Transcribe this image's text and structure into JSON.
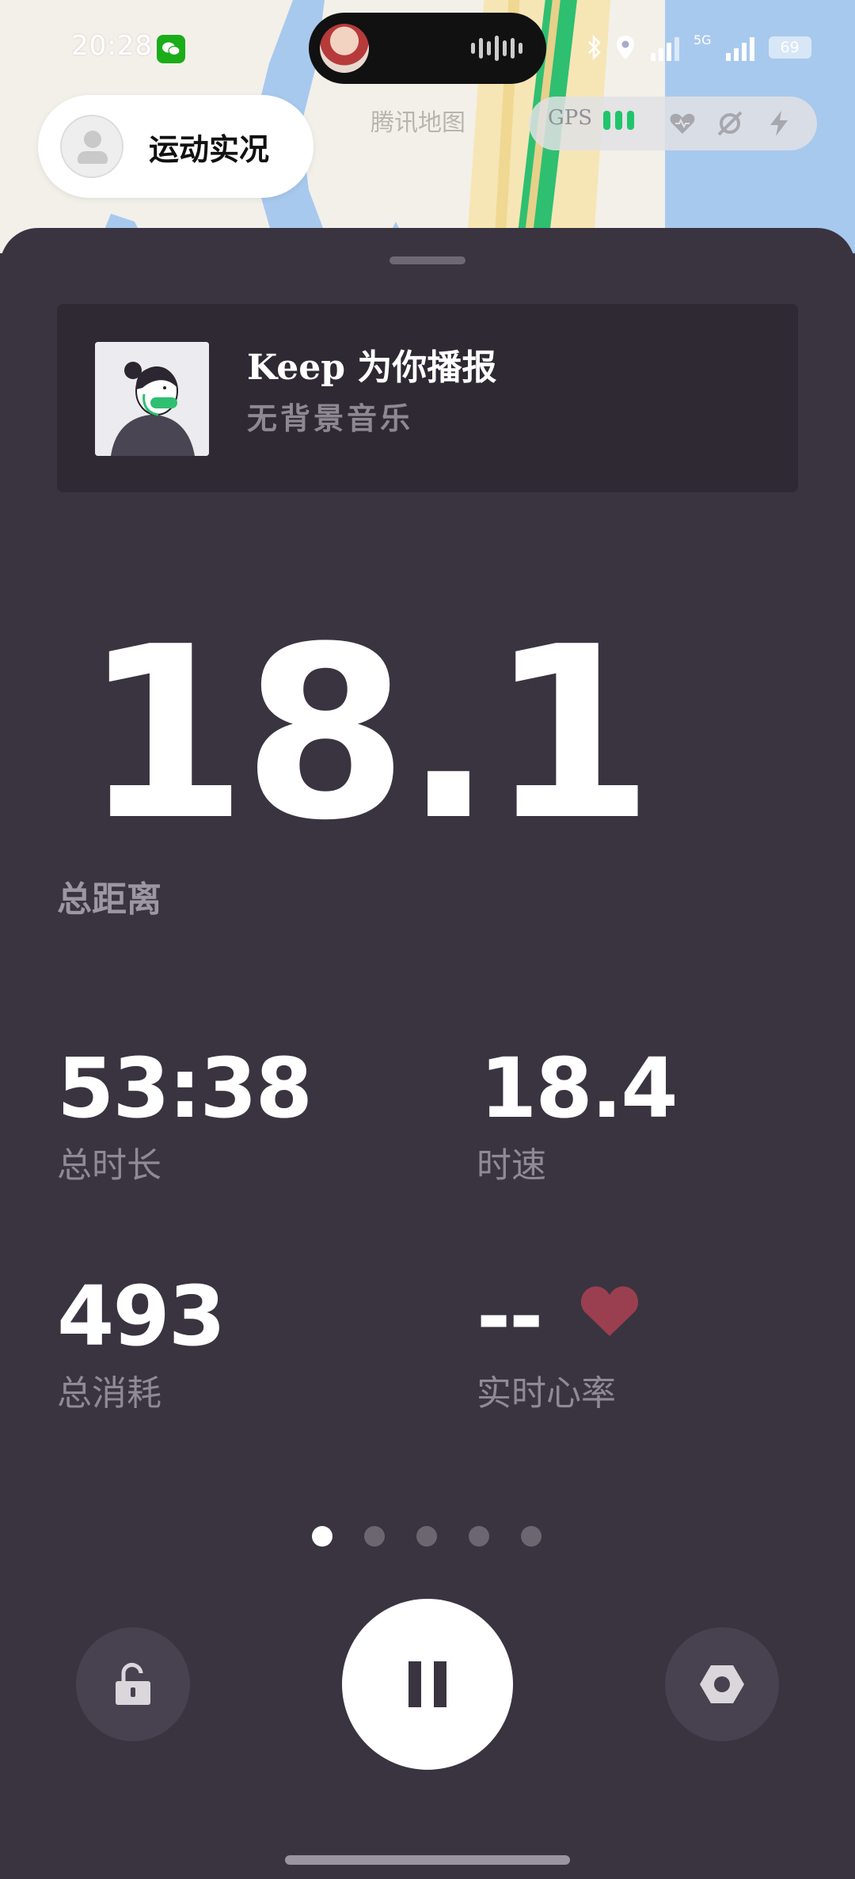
{
  "status_bar": {
    "time": "20:28",
    "network": "5G",
    "battery": "69"
  },
  "map": {
    "live_label": "运动实况",
    "brand": "腾讯地图",
    "gps_label": "GPS"
  },
  "music_card": {
    "title": "Keep 为你播报",
    "subtitle": "无背景音乐"
  },
  "main_stat": {
    "value": "18.1",
    "label": "总距离"
  },
  "metrics": {
    "duration": {
      "value": "53:38",
      "label": "总时长"
    },
    "speed": {
      "value": "18.4",
      "label": "时速"
    },
    "calories": {
      "value": "493",
      "label": "总消耗"
    },
    "heart_rate": {
      "value": "--",
      "label": "实时心率"
    }
  },
  "pager": {
    "count": 5,
    "active_index": 0
  },
  "controls": {
    "lock_icon": "lock-open-icon",
    "pause_icon": "pause-icon",
    "settings_icon": "hexagon-settings-icon"
  },
  "colors": {
    "panel": "#3a3441",
    "card": "#2e2933",
    "gps_green": "#21c46b",
    "road_green": "#2fbf71",
    "heart": "#9a3f50",
    "water": "#a8c9ee"
  }
}
